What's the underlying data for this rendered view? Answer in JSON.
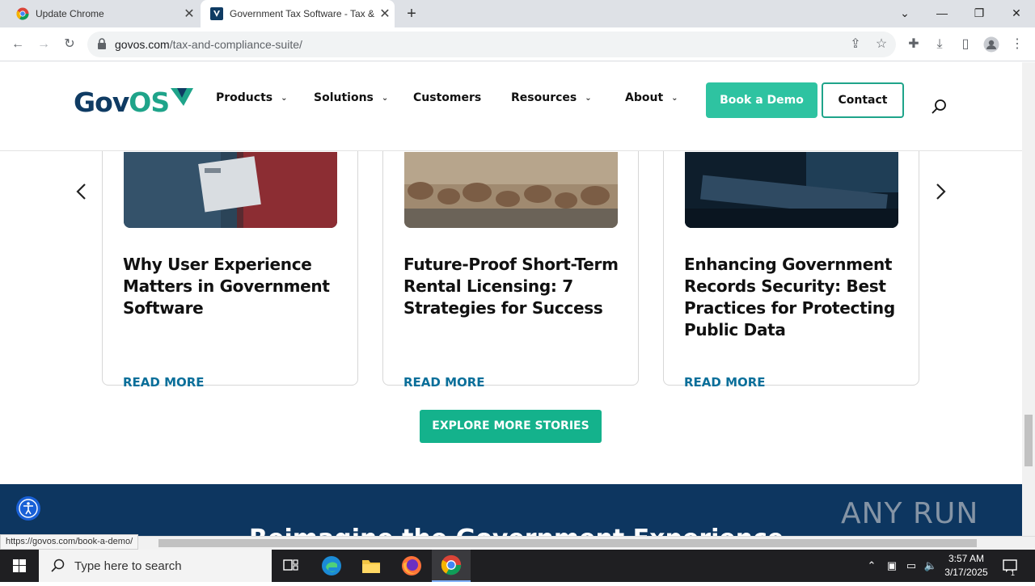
{
  "browser": {
    "tabs": [
      {
        "title": "Update Chrome"
      },
      {
        "title": "Government Tax Software - Tax & Compliance"
      }
    ],
    "url_domain": "govos.com",
    "url_path": "/tax-and-compliance-suite/",
    "status_url": "https://govos.com/book-a-demo/"
  },
  "site": {
    "logo_gov": "Gov",
    "logo_os": "OS",
    "nav": [
      {
        "label": "Products"
      },
      {
        "label": "Solutions"
      },
      {
        "label": "Customers"
      },
      {
        "label": "Resources"
      },
      {
        "label": "About"
      }
    ],
    "book_demo": "Book a Demo",
    "contact": "Contact"
  },
  "stories": {
    "cards": [
      {
        "title": "Why User Experience Matters in Government Software",
        "cta": "READ MORE"
      },
      {
        "title": "Future-Proof Short-Term Rental Licensing: 7 Strategies for Success",
        "cta": "READ MORE"
      },
      {
        "title": "Enhancing Government Records Security: Best Practices for Protecting Public Data",
        "cta": "READ MORE"
      }
    ],
    "explore_label": "EXPLORE MORE STORIES"
  },
  "footer": {
    "title": "Reimagine the Government Experience",
    "watermark": "ANY RUN"
  },
  "taskbar": {
    "search_placeholder": "Type here to search",
    "time": "3:57 AM",
    "date": "3/17/2025",
    "notification_count": "1"
  }
}
